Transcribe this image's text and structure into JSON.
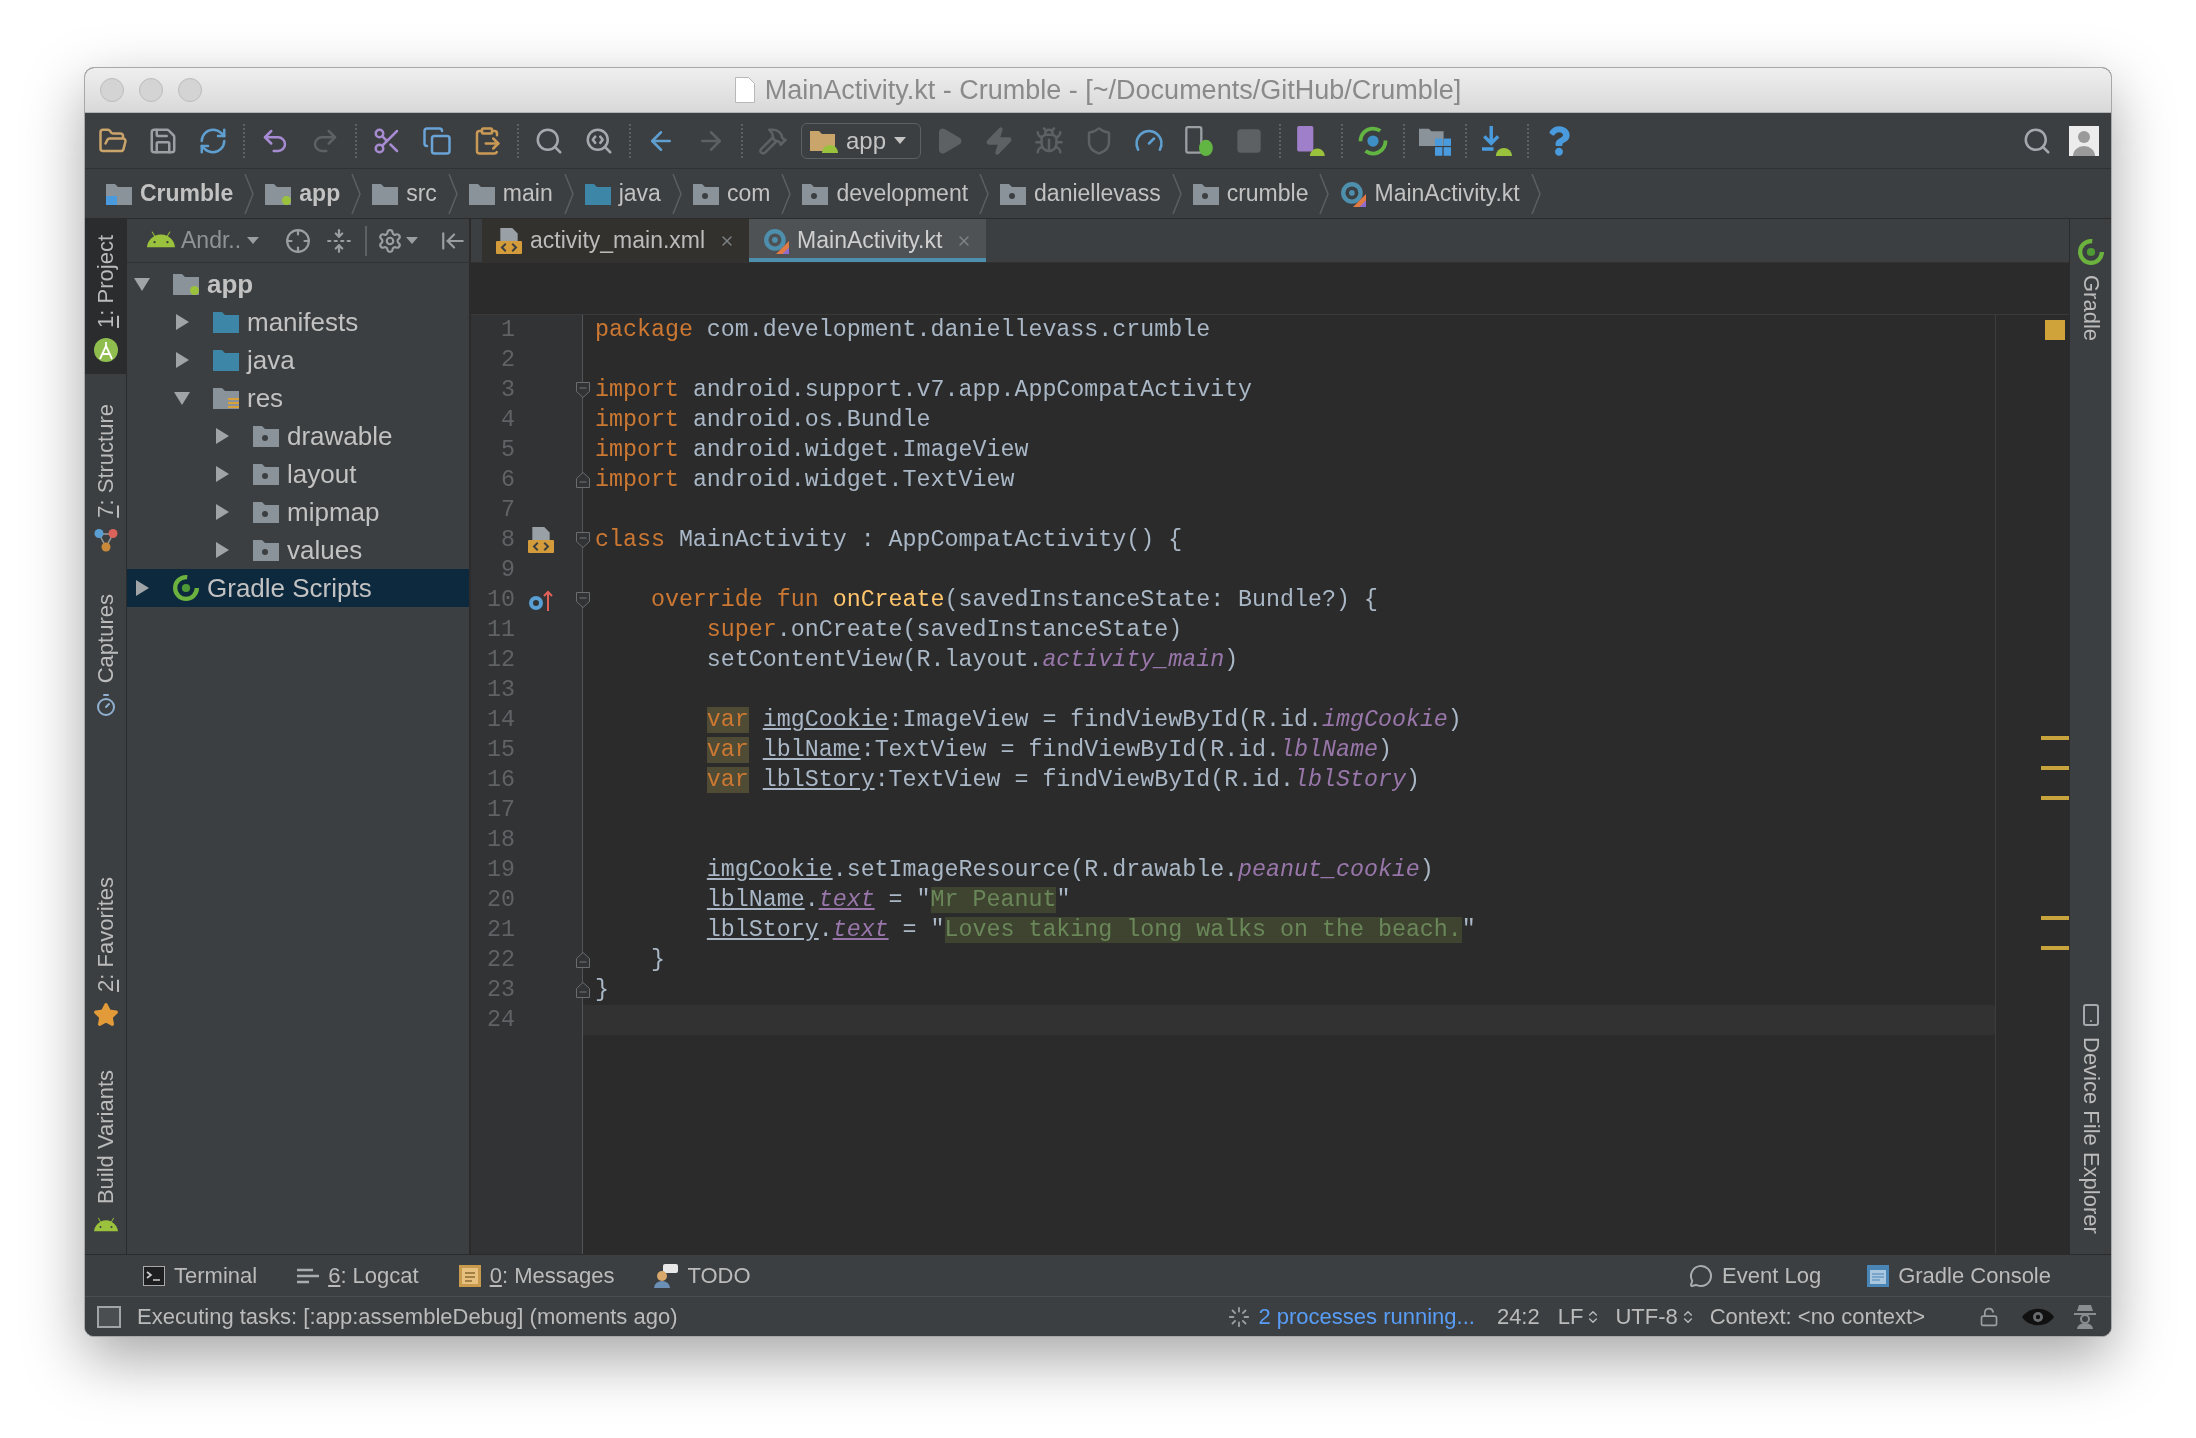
{
  "window": {
    "title": "MainActivity.kt - Crumble - [~/Documents/GitHub/Crumble]"
  },
  "toolbar": {
    "run_configuration": "app"
  },
  "navigation_bar": [
    {
      "label": "Crumble",
      "kind": "project"
    },
    {
      "label": "app",
      "kind": "module"
    },
    {
      "label": "src",
      "kind": "folder"
    },
    {
      "label": "main",
      "kind": "folder"
    },
    {
      "label": "java",
      "kind": "source"
    },
    {
      "label": "com",
      "kind": "package"
    },
    {
      "label": "development",
      "kind": "package"
    },
    {
      "label": "daniellevass",
      "kind": "package"
    },
    {
      "label": "crumble",
      "kind": "package"
    },
    {
      "label": "MainActivity.kt",
      "kind": "kotlin"
    }
  ],
  "left_tool_strip": {
    "top": [
      {
        "mnemonic": "1",
        "label": ": Project",
        "kind": "project",
        "selected": true
      },
      {
        "mnemonic": "7",
        "label": ": Structure",
        "kind": "structure",
        "selected": false
      },
      {
        "label": "Captures",
        "kind": "captures",
        "selected": false
      }
    ],
    "bottom": [
      {
        "mnemonic": "2",
        "label": ": Favorites",
        "kind": "favorites",
        "selected": false
      },
      {
        "label": "Build Variants",
        "kind": "build_variants",
        "selected": false
      }
    ]
  },
  "project_panel": {
    "view": "Andr..",
    "tree": [
      {
        "label": "app",
        "kind": "module",
        "expanded": true,
        "selected": false,
        "children": [
          {
            "label": "manifests",
            "kind": "source",
            "expanded": false,
            "selected": false
          },
          {
            "label": "java",
            "kind": "source",
            "expanded": false,
            "selected": false
          },
          {
            "label": "res",
            "kind": "res",
            "expanded": true,
            "selected": false,
            "children": [
              {
                "label": "drawable",
                "kind": "package",
                "expanded": false,
                "selected": false
              },
              {
                "label": "layout",
                "kind": "package",
                "expanded": false,
                "selected": false
              },
              {
                "label": "mipmap",
                "kind": "package",
                "expanded": false,
                "selected": false
              },
              {
                "label": "values",
                "kind": "package",
                "expanded": false,
                "selected": false
              }
            ]
          }
        ]
      },
      {
        "label": "Gradle Scripts",
        "kind": "gradle",
        "expanded": false,
        "selected": true
      }
    ]
  },
  "editor": {
    "tabs": [
      {
        "label": "activity_main.xml",
        "kind": "xml",
        "selected": false
      },
      {
        "label": "MainActivity.kt",
        "kind": "kotlin",
        "selected": true
      }
    ],
    "lines": [
      {
        "number": "1",
        "current": false,
        "warning": false,
        "tokens": [
          {
            "kind": "keyword",
            "text": "package"
          },
          {
            "kind": "plain",
            "text": " com.development.daniellevass.crumble"
          }
        ]
      },
      {
        "number": "2",
        "current": false,
        "warning": false
      },
      {
        "number": "3",
        "fold_marker": {
          "kind": "start"
        },
        "current": false,
        "warning": false,
        "tokens": [
          {
            "kind": "keyword",
            "text": "import"
          },
          {
            "kind": "plain",
            "text": " android.support.v7.app.AppCompatActivity"
          }
        ]
      },
      {
        "number": "4",
        "current": false,
        "warning": false,
        "tokens": [
          {
            "kind": "keyword",
            "text": "import"
          },
          {
            "kind": "plain",
            "text": " android.os.Bundle"
          }
        ]
      },
      {
        "number": "5",
        "current": false,
        "warning": false,
        "tokens": [
          {
            "kind": "keyword",
            "text": "import"
          },
          {
            "kind": "plain",
            "text": " android.widget.ImageView"
          }
        ]
      },
      {
        "number": "6",
        "fold_marker": {
          "kind": "end"
        },
        "current": false,
        "warning": false,
        "tokens": [
          {
            "kind": "keyword",
            "text": "import"
          },
          {
            "kind": "plain",
            "text": " android.widget.TextView"
          }
        ]
      },
      {
        "number": "7",
        "current": false,
        "warning": false
      },
      {
        "number": "8",
        "fold_marker": {
          "kind": "start"
        },
        "gutter_icon": {
          "kind": "layout"
        },
        "current": false,
        "warning": false,
        "tokens": [
          {
            "kind": "keyword",
            "text": "class"
          },
          {
            "kind": "plain",
            "text": " MainActivity : AppCompatActivity() {"
          }
        ]
      },
      {
        "number": "9",
        "current": false,
        "warning": false
      },
      {
        "number": "10",
        "fold_marker": {
          "kind": "start"
        },
        "gutter_icon": {
          "kind": "override"
        },
        "current": false,
        "warning": false,
        "tokens": [
          {
            "kind": "keyword",
            "text": "    override fun"
          },
          {
            "kind": "function",
            "text": " onCreate"
          },
          {
            "kind": "plain",
            "text": "(savedInstanceState: Bundle?) {"
          }
        ]
      },
      {
        "number": "11",
        "current": false,
        "warning": false,
        "tokens": [
          {
            "kind": "keyword",
            "text": "        super"
          },
          {
            "kind": "plain",
            "text": ".onCreate(savedInstanceState)"
          }
        ]
      },
      {
        "number": "12",
        "current": false,
        "warning": false,
        "tokens": [
          {
            "kind": "plain",
            "text": "        setContentView(R.layout."
          },
          {
            "kind": "field",
            "text": "activity_main"
          },
          {
            "kind": "plain",
            "text": ")"
          }
        ]
      },
      {
        "number": "13",
        "current": false,
        "warning": false
      },
      {
        "number": "14",
        "current": false,
        "warning": true,
        "tokens": [
          {
            "kind": "keyword_warning",
            "text": "        var"
          },
          {
            "kind": "variable",
            "text": " imgCookie"
          },
          {
            "kind": "plain",
            "text": ":ImageView = findViewById(R.id."
          },
          {
            "kind": "field",
            "text": "imgCookie"
          },
          {
            "kind": "plain",
            "text": ")"
          }
        ]
      },
      {
        "number": "15",
        "current": false,
        "warning": true,
        "tokens": [
          {
            "kind": "keyword_warning",
            "text": "        var"
          },
          {
            "kind": "variable",
            "text": " lblName"
          },
          {
            "kind": "plain",
            "text": ":TextView = findViewById(R.id."
          },
          {
            "kind": "field",
            "text": "lblName"
          },
          {
            "kind": "plain",
            "text": ")"
          }
        ]
      },
      {
        "number": "16",
        "current": false,
        "warning": true,
        "tokens": [
          {
            "kind": "keyword_warning",
            "text": "        var"
          },
          {
            "kind": "variable",
            "text": " lblStory"
          },
          {
            "kind": "plain",
            "text": ":TextView = findViewById(R.id."
          },
          {
            "kind": "field",
            "text": "lblStory"
          },
          {
            "kind": "plain",
            "text": ")"
          }
        ]
      },
      {
        "number": "17",
        "current": false,
        "warning": false
      },
      {
        "number": "18",
        "current": false,
        "warning": false
      },
      {
        "number": "19",
        "current": false,
        "warning": false,
        "tokens": [
          {
            "kind": "variable",
            "text": "        imgCookie"
          },
          {
            "kind": "plain",
            "text": ".setImageResource(R.drawable."
          },
          {
            "kind": "field",
            "text": "peanut_cookie"
          },
          {
            "kind": "plain",
            "text": ")"
          }
        ]
      },
      {
        "number": "20",
        "current": false,
        "warning": true,
        "tokens": [
          {
            "kind": "variable",
            "text": "        lblName"
          },
          {
            "kind": "plain",
            "text": "."
          },
          {
            "kind": "property",
            "text": "text"
          },
          {
            "kind": "plain",
            "text": " = \""
          },
          {
            "kind": "string_warning",
            "text": "Mr Peanut"
          },
          {
            "kind": "plain",
            "text": "\""
          }
        ]
      },
      {
        "number": "21",
        "current": false,
        "warning": true,
        "tokens": [
          {
            "kind": "variable",
            "text": "        lblStory"
          },
          {
            "kind": "plain",
            "text": "."
          },
          {
            "kind": "property",
            "text": "text"
          },
          {
            "kind": "plain",
            "text": " = \""
          },
          {
            "kind": "string_warning",
            "text": "Loves taking long walks on the beach."
          },
          {
            "kind": "plain",
            "text": "\""
          }
        ]
      },
      {
        "number": "22",
        "fold_marker": {
          "kind": "end"
        },
        "current": false,
        "warning": false,
        "tokens": [
          {
            "kind": "plain",
            "text": "    }"
          }
        ]
      },
      {
        "number": "23",
        "fold_marker": {
          "kind": "end"
        },
        "current": false,
        "warning": false,
        "tokens": [
          {
            "kind": "plain",
            "text": "}"
          }
        ]
      },
      {
        "number": "24",
        "current": true,
        "warning": false
      }
    ]
  },
  "right_tool_strip": {
    "top": [
      {
        "label": "Gradle",
        "kind": "gradle",
        "selected": false
      }
    ],
    "bottom": [
      {
        "label": "Device File Explorer",
        "kind": "device",
        "selected": false
      }
    ]
  },
  "bottom_tool_bar": {
    "left": [
      {
        "label": "Terminal",
        "kind": "terminal",
        "selected": false
      },
      {
        "mnemonic": "6",
        "label": ": Logcat",
        "kind": "logcat",
        "selected": false
      },
      {
        "mnemonic": "0",
        "label": ": Messages",
        "kind": "messages",
        "selected": false
      },
      {
        "label": "TODO",
        "kind": "todo",
        "selected": false
      }
    ],
    "right": [
      {
        "label": "Event Log",
        "kind": "event_log",
        "selected": false
      },
      {
        "label": "Gradle Console",
        "kind": "gradle_console",
        "selected": false
      }
    ]
  },
  "status_bar": {
    "message": "Executing tasks: [:app:assembleDebug] (moments ago)",
    "processes": "2 processes running...",
    "caret": "24:2",
    "line_separator": "LF",
    "encoding": "UTF-8",
    "context": "Context: <no context>"
  }
}
